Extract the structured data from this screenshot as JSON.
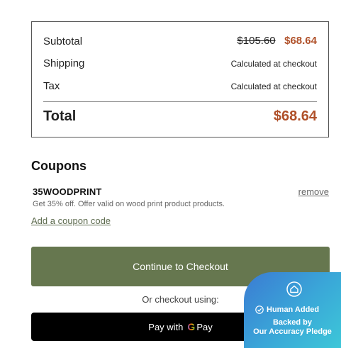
{
  "summary": {
    "subtotal_label": "Subtotal",
    "subtotal_original": "$105.60",
    "subtotal_sale": "$68.64",
    "shipping_label": "Shipping",
    "shipping_value": "Calculated at checkout",
    "tax_label": "Tax",
    "tax_value": "Calculated at checkout",
    "total_label": "Total",
    "total_value": "$68.64"
  },
  "coupons": {
    "title": "Coupons",
    "code": "35WOODPRINT",
    "remove_label": "remove",
    "description": "Get 35% off. Offer valid on wood print product products.",
    "add_label": "Add a coupon code"
  },
  "checkout": {
    "continue_label": "Continue to Checkout",
    "or_label": "Or checkout using:",
    "gpay_prefix": "Pay with",
    "gpay_g": "G",
    "gpay_suffix": "Pay"
  },
  "badge": {
    "added_label": "Human Added",
    "line1": "Backed by",
    "line2": "Our Accuracy Pledge",
    "icon": "house-shield-icon"
  },
  "colors": {
    "accent_green": "#66774f",
    "sale_price": "#b0512a",
    "badge_gradient_start": "#3b7bd3",
    "badge_gradient_end": "#3dc7d8"
  }
}
